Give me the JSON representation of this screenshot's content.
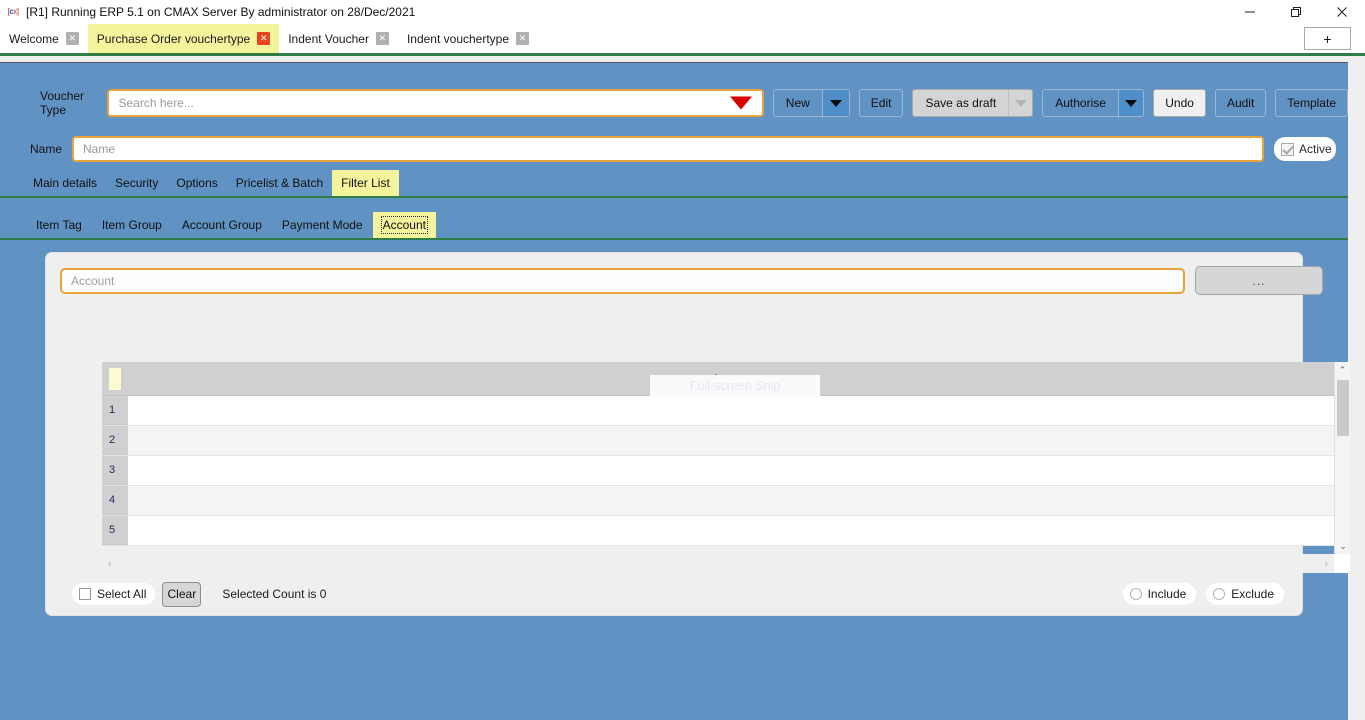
{
  "window": {
    "title": "[R1] Running ERP 5.1 on CMAX Server By administrator on 28/Dec/2021",
    "app_icon": "cmax-app-icon",
    "minimize_label": "Minimize",
    "restore_label": "Restore",
    "close_label": "Close"
  },
  "tabstrip": {
    "tabs": [
      {
        "label": "Welcome",
        "active": false
      },
      {
        "label": "Purchase Order vouchertype",
        "active": true
      },
      {
        "label": "Indent Voucher",
        "active": false
      },
      {
        "label": "Indent vouchertype",
        "active": false
      }
    ],
    "close_glyph": "✕",
    "new_tab_label": "+"
  },
  "form": {
    "voucher_type_label": "Voucher Type",
    "voucher_type_placeholder": "Search here...",
    "voucher_type_value": "",
    "name_label": "Name",
    "name_placeholder": "Name",
    "name_value": "",
    "active_label": "Active",
    "active_checked": true
  },
  "toolbar": {
    "new_label": "New",
    "edit_label": "Edit",
    "save_as_draft_label": "Save as draft",
    "authorise_label": "Authorise",
    "undo_label": "Undo",
    "audit_label": "Audit",
    "template_label": "Template"
  },
  "main_tabs": [
    {
      "label": "Main details",
      "active": false
    },
    {
      "label": "Security",
      "active": false
    },
    {
      "label": "Options",
      "active": false
    },
    {
      "label": "Pricelist & Batch",
      "active": false
    },
    {
      "label": "Filter List",
      "active": true
    }
  ],
  "sub_tabs": [
    {
      "label": "Item Tag",
      "active": false
    },
    {
      "label": "Item Group",
      "active": false
    },
    {
      "label": "Account Group",
      "active": false
    },
    {
      "label": "Payment Mode",
      "active": false
    },
    {
      "label": "Account",
      "active": true
    }
  ],
  "panel": {
    "account_placeholder": "Account",
    "account_value": "",
    "browse_label": "...",
    "grid": {
      "column_header": "Account",
      "rows": [
        {
          "number": "1",
          "account": ""
        },
        {
          "number": "2",
          "account": ""
        },
        {
          "number": "3",
          "account": ""
        },
        {
          "number": "4",
          "account": ""
        },
        {
          "number": "5",
          "account": ""
        }
      ],
      "scroll_up_glyph": "⌃",
      "scroll_down_glyph": "⌄",
      "scroll_left_glyph": "‹",
      "scroll_right_glyph": "›"
    },
    "ghost_tooltip": "Full-screen Snip",
    "footer": {
      "select_all_label": "Select All",
      "select_all_checked": false,
      "clear_label": "Clear",
      "selected_count_text": "Selected Count is 0",
      "include_label": "Include",
      "include_selected": false,
      "exclude_label": "Exclude",
      "exclude_selected": false
    }
  },
  "colors": {
    "workarea_blue": "#6093c4",
    "accent_tab_yellow": "#f4f49c",
    "underline_green": "#2e7d46",
    "field_border_orange": "#e8a33d",
    "dropdown_red": "#d90000"
  }
}
